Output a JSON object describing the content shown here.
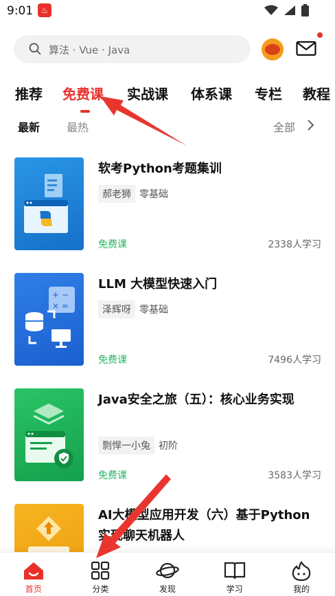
{
  "status_bar": {
    "time": "9:01"
  },
  "search": {
    "placeholder": "算法 · Vue · Java"
  },
  "tabs": [
    "推荐",
    "免费课",
    "实战课",
    "体系课",
    "专栏",
    "教程"
  ],
  "active_tab_index": 1,
  "filters": {
    "newest": "最新",
    "hottest": "最热",
    "all": "全部"
  },
  "courses": [
    {
      "title": "软考Python考题集训",
      "author": "郝老狮",
      "level": "零基础",
      "price": "免费课",
      "learners": "2338人学习",
      "thumb_color": "#1e86d8"
    },
    {
      "title": "LLM 大模型快速入门",
      "author": "泽辉呀",
      "level": "零基础",
      "price": "免费课",
      "learners": "7496人学习",
      "thumb_color": "#2470dd"
    },
    {
      "title": "Java安全之旅（五）：核心业务实现",
      "author": "剽悍一小兔",
      "level": "初阶",
      "price": "免费课",
      "learners": "3583人学习",
      "thumb_color": "#1bb35a"
    },
    {
      "title": "AI大模型应用开发（六）基于Python实现聊天机器人",
      "author": "",
      "level": "",
      "price": "",
      "learners": "",
      "thumb_color": "#f2a516"
    }
  ],
  "bottom_nav": [
    {
      "label": "首页",
      "icon": "home-icon"
    },
    {
      "label": "分类",
      "icon": "grid-icon"
    },
    {
      "label": "发现",
      "icon": "planet-icon"
    },
    {
      "label": "学习",
      "icon": "book-icon"
    },
    {
      "label": "我的",
      "icon": "profile-icon"
    }
  ],
  "colors": {
    "accent": "#e8312a",
    "free": "#29b765"
  }
}
